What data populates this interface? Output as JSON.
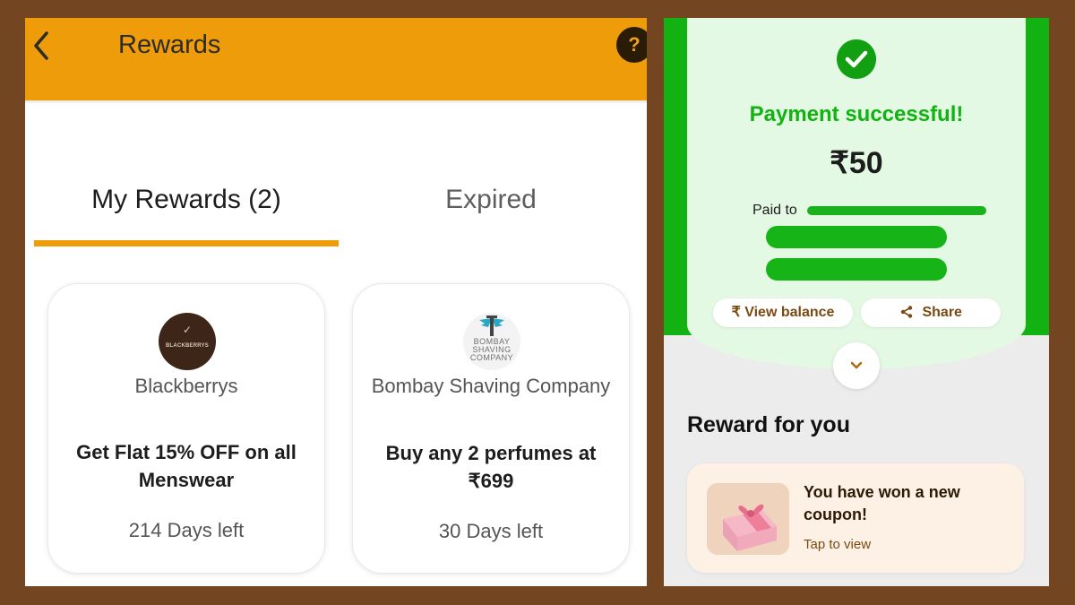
{
  "rewards_app": {
    "title": "Rewards",
    "help_label": "?",
    "tabs": [
      {
        "label": "My Rewards (2)",
        "active": true
      },
      {
        "label": "Expired",
        "active": false
      }
    ],
    "cards": [
      {
        "logo_text": "BLACKBERRYS",
        "brand": "Blackberrys",
        "offer": "Get Flat 15% OFF on all Menswear",
        "days_left": "214 Days left"
      },
      {
        "logo_text": "BOMBAY SHAVING COMPANY",
        "brand": "Bombay Shaving Company",
        "offer": "Buy any 2 perfumes at ₹699",
        "days_left": "30 Days left"
      }
    ],
    "colors": {
      "accent": "#ef9c0b",
      "background": "#734520"
    }
  },
  "payment": {
    "status": "Payment successful!",
    "amount": "₹50",
    "paid_to_label": "Paid to",
    "buttons": {
      "view_balance": "View balance",
      "share": "Share"
    },
    "reward_heading": "Reward for you",
    "reward_card": {
      "title": "You have won a new coupon!",
      "cta": "Tap to view"
    },
    "colors": {
      "success": "#12b212"
    }
  }
}
